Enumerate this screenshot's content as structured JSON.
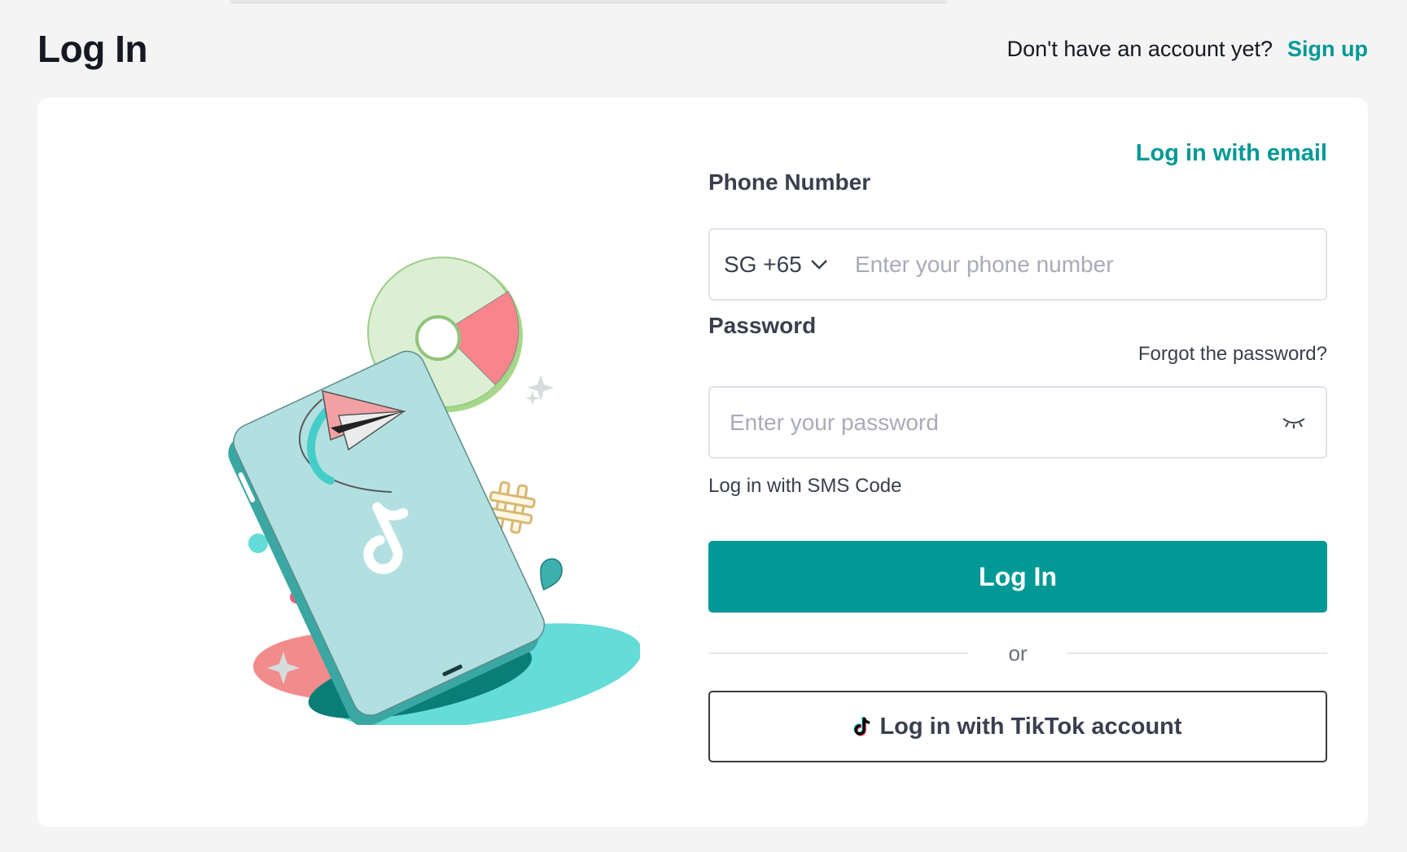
{
  "header": {
    "title": "Log In",
    "signup_prompt": "Don't have an account yet?",
    "signup_link": "Sign up"
  },
  "form": {
    "email_toggle": "Log in with email",
    "phone_label": "Phone Number",
    "country_code": "SG +65",
    "phone_placeholder": "Enter your phone number",
    "password_label": "Password",
    "forgot_password": "Forgot the password?",
    "password_placeholder": "Enter your password",
    "sms_link": "Log in with SMS Code",
    "login_button": "Log In",
    "divider_text": "or",
    "tiktok_button": "Log in with TikTok account"
  },
  "colors": {
    "accent": "#009995",
    "background": "#f4f4f4",
    "card": "#ffffff",
    "text": "#161823"
  },
  "icons": {
    "country_dropdown": "chevron-down-icon",
    "password_toggle": "eye-closed-icon",
    "tiktok": "tiktok-logo-icon"
  }
}
